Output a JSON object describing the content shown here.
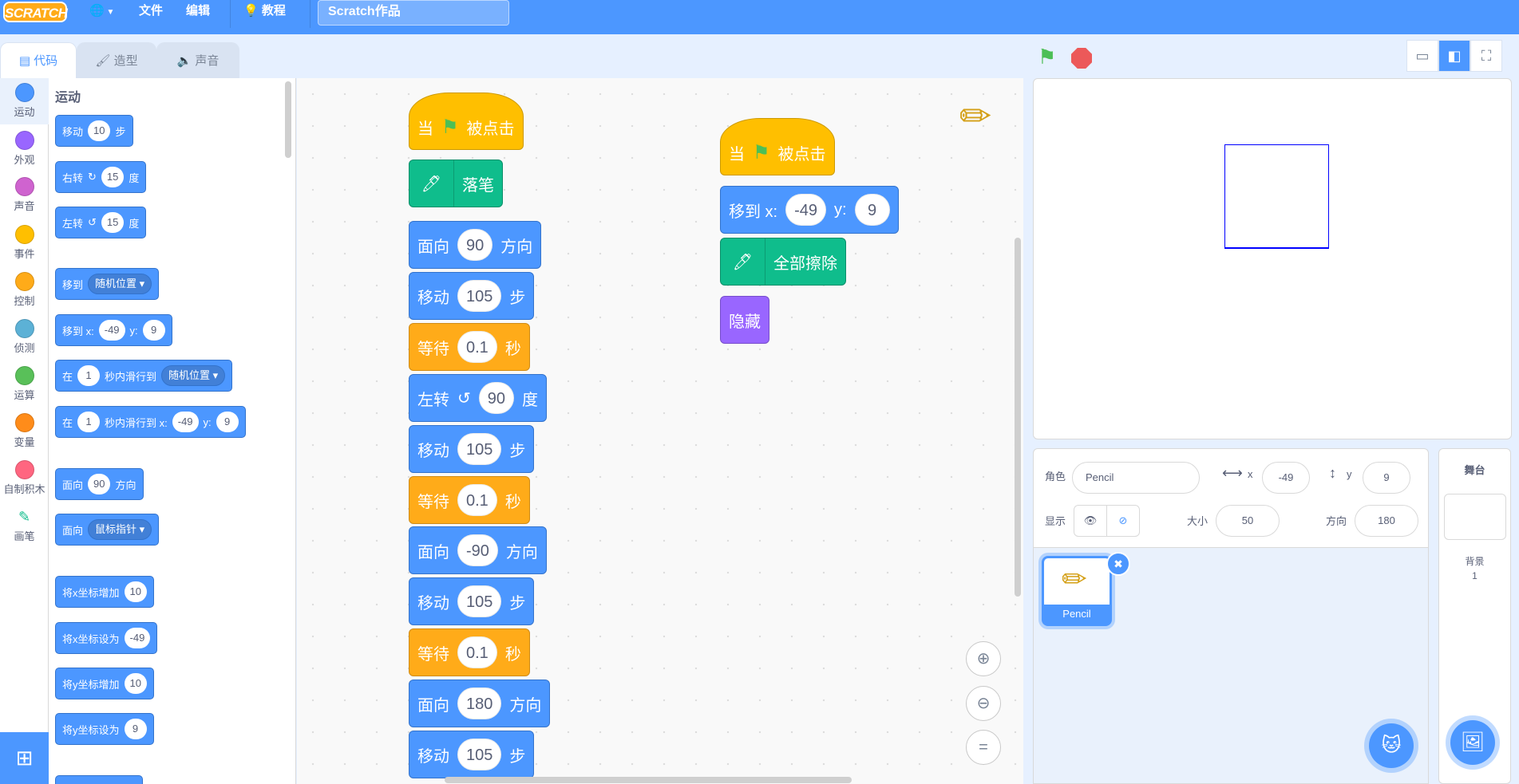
{
  "menubar": {
    "logo": "SCRATCH",
    "file": "文件",
    "edit": "编辑",
    "tutorials": "教程",
    "project_title": "Scratch作品"
  },
  "tabs": [
    {
      "label": "代码",
      "icon": "code-icon"
    },
    {
      "label": "造型",
      "icon": "brush-icon"
    },
    {
      "label": "声音",
      "icon": "speaker-icon"
    }
  ],
  "categories": [
    {
      "label": "运动",
      "color": "#4c97ff"
    },
    {
      "label": "外观",
      "color": "#9966ff"
    },
    {
      "label": "声音",
      "color": "#cf63cf"
    },
    {
      "label": "事件",
      "color": "#ffbf00"
    },
    {
      "label": "控制",
      "color": "#ffab19"
    },
    {
      "label": "侦测",
      "color": "#5cb1d6"
    },
    {
      "label": "运算",
      "color": "#59c059"
    },
    {
      "label": "变量",
      "color": "#ff8c1a"
    },
    {
      "label": "自制积木",
      "color": "#ff6680"
    },
    {
      "label": "画笔",
      "color": "#0fbd8c"
    }
  ],
  "palette": {
    "heading": "运动",
    "move": {
      "pre": "移动",
      "val": "10",
      "post": "步"
    },
    "turn_right": {
      "pre": "右转",
      "val": "15",
      "post": "度"
    },
    "turn_left": {
      "pre": "左转",
      "val": "15",
      "post": "度"
    },
    "goto": {
      "pre": "移到",
      "dd": "随机位置"
    },
    "goto_xy": {
      "pre": "移到 x:",
      "x": "-49",
      "ylab": "y:",
      "y": "9"
    },
    "glide": {
      "pre": "在",
      "val": "1",
      "mid": "秒内滑行到",
      "dd": "随机位置"
    },
    "glide_xy": {
      "pre": "在",
      "val": "1",
      "mid": "秒内滑行到 x:",
      "x": "-49",
      "ylab": "y:",
      "y": "9"
    },
    "point_dir": {
      "pre": "面向",
      "val": "90",
      "post": "方向"
    },
    "point_towards": {
      "pre": "面向",
      "dd": "鼠标指针"
    },
    "change_x": {
      "pre": "将x坐标增加",
      "val": "10"
    },
    "set_x": {
      "pre": "将x坐标设为",
      "val": "-49"
    },
    "change_y": {
      "pre": "将y坐标增加",
      "val": "10"
    },
    "set_y": {
      "pre": "将y坐标设为",
      "val": "9"
    }
  },
  "script1": {
    "hat": {
      "pre": "当",
      "post": "被点击"
    },
    "pen_down": "落笔",
    "b1": {
      "pre": "面向",
      "val": "90",
      "post": "方向"
    },
    "b2": {
      "pre": "移动",
      "val": "105",
      "post": "步"
    },
    "b3": {
      "pre": "等待",
      "val": "0.1",
      "post": "秒"
    },
    "b4": {
      "pre": "左转",
      "val": "90",
      "post": "度"
    },
    "b5": {
      "pre": "移动",
      "val": "105",
      "post": "步"
    },
    "b6": {
      "pre": "等待",
      "val": "0.1",
      "post": "秒"
    },
    "b7": {
      "pre": "面向",
      "val": "-90",
      "post": "方向"
    },
    "b8": {
      "pre": "移动",
      "val": "105",
      "post": "步"
    },
    "b9": {
      "pre": "等待",
      "val": "0.1",
      "post": "秒"
    },
    "b10": {
      "pre": "面向",
      "val": "180",
      "post": "方向"
    },
    "b11": {
      "pre": "移动",
      "val": "105",
      "post": "步"
    }
  },
  "script2": {
    "hat": {
      "pre": "当",
      "post": "被点击"
    },
    "goto": {
      "pre": "移到 x:",
      "x": "-49",
      "ylab": "y:",
      "y": "9"
    },
    "clear": "全部擦除",
    "hide": "隐藏"
  },
  "sprite_info": {
    "sprite_label": "角色",
    "sprite_name": "Pencil",
    "x_label": "x",
    "x_value": "-49",
    "y_label": "y",
    "y_value": "9",
    "show_label": "显示",
    "size_label": "大小",
    "size_value": "50",
    "direction_label": "方向",
    "direction_value": "180"
  },
  "sprites": [
    {
      "name": "Pencil"
    }
  ],
  "stage_panel": {
    "title": "舞台",
    "backdrop_label": "背景",
    "backdrop_count": "1"
  }
}
